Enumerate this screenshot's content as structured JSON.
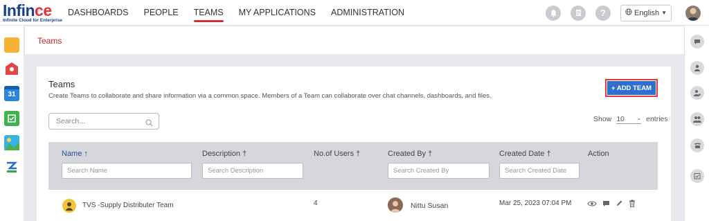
{
  "app": {
    "logo_word_a": "Infin",
    "logo_word_b": "ce",
    "logo_tagline": "Infinite Cloud for Enterprise"
  },
  "nav": {
    "items": [
      {
        "label": "DASHBOARDS",
        "active": false
      },
      {
        "label": "PEOPLE",
        "active": false
      },
      {
        "label": "TEAMS",
        "active": true
      },
      {
        "label": "MY APPLICATIONS",
        "active": false
      },
      {
        "label": "ADMINISTRATION",
        "active": false
      }
    ],
    "language": "English",
    "icons": [
      "bell-icon",
      "tasks-icon",
      "help-icon"
    ]
  },
  "breadcrumb": {
    "current": "Teams"
  },
  "page": {
    "title": "Teams",
    "description": "Create Teams to collaborate and share information via a common space. Members of a Team can collaborate over chat channels, dashboards, and files.",
    "add_button": "+ ADD TEAM",
    "search_placeholder": "Search...",
    "show_label": "Show",
    "show_value": "10",
    "entries_label": "entries"
  },
  "table": {
    "columns": [
      {
        "label": "Name ↑",
        "filter_placeholder": "Search Name"
      },
      {
        "label": "Description †",
        "filter_placeholder": "Search Description"
      },
      {
        "label": "No.of Users †",
        "filter_placeholder": ""
      },
      {
        "label": "Created By †",
        "filter_placeholder": "Search Created By"
      },
      {
        "label": "Created Date †",
        "filter_placeholder": "Search Created Date"
      },
      {
        "label": "Action",
        "filter_placeholder": ""
      }
    ],
    "rows": [
      {
        "name": "TVS -Supply Distributer Team",
        "description": "",
        "users": "4",
        "created_by": "Nittu Susan",
        "created_date": "Mar 25, 2023 07:04 PM",
        "actions": [
          "view-icon",
          "chat-icon",
          "edit-icon",
          "delete-icon"
        ]
      }
    ]
  },
  "colors": {
    "accent_red": "#d32f2f",
    "primary_blue": "#2f6fcf",
    "header_gray": "#d6d7dc"
  }
}
